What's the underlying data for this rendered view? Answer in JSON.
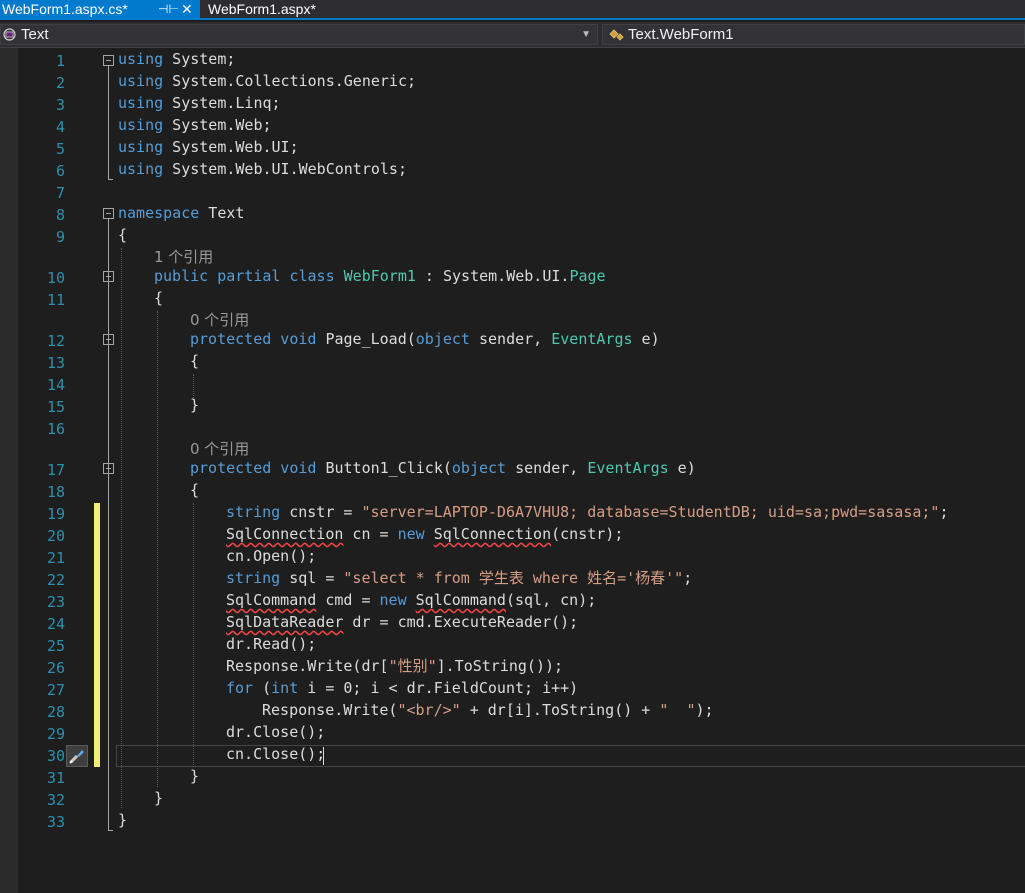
{
  "tabs": [
    {
      "label": "WebForm1.aspx.cs*",
      "active": true,
      "pinned_icon": "pin-icon",
      "close_icon": "close-icon"
    },
    {
      "label": "WebForm1.aspx*",
      "active": false
    }
  ],
  "navbar": {
    "project_dropdown": {
      "value": "Text",
      "icon": "csharp-project-icon"
    },
    "class_dropdown": {
      "value": "Text.WebForm1",
      "icon": "class-icon"
    }
  },
  "colors": {
    "keyword": "#569cd6",
    "type": "#4ec9b0",
    "string": "#d69d85",
    "text": "#dcdcdc",
    "line_number": "#2b91af",
    "hint": "#999999",
    "accent": "#007acc",
    "change_marker": "#efef7a",
    "error_squiggle": "#f44747"
  },
  "line_numbers": [
    "1",
    "2",
    "3",
    "4",
    "5",
    "6",
    "7",
    "8",
    "9",
    "10",
    "11",
    "12",
    "13",
    "14",
    "15",
    "16",
    "17",
    "18",
    "19",
    "20",
    "21",
    "22",
    "23",
    "24",
    "25",
    "26",
    "27",
    "28",
    "29",
    "30",
    "31",
    "32",
    "33"
  ],
  "hints": {
    "class_refs": "1 个引用",
    "page_load_refs": "0 个引用",
    "button_click_refs": "0 个引用"
  },
  "code": {
    "l1": {
      "kw": "using",
      "rest": " System;"
    },
    "l2": {
      "kw": "using",
      "rest": " System.Collections.Generic;"
    },
    "l3": {
      "kw": "using",
      "rest": " System.Linq;"
    },
    "l4": {
      "kw": "using",
      "rest": " System.Web;"
    },
    "l5": {
      "kw": "using",
      "rest": " System.Web.UI;"
    },
    "l6": {
      "kw": "using",
      "rest": " System.Web.UI.WebControls;"
    },
    "l8": {
      "kw": "namespace",
      "rest": " Text"
    },
    "l9": {
      "text": "{"
    },
    "l10": {
      "kw1": "public",
      "kw2": " partial",
      "kw3": " class",
      "name": " WebForm1",
      "sep": " : System.Web.UI.",
      "base": "Page"
    },
    "l11": {
      "text": "{"
    },
    "l12": {
      "kw1": "protected",
      "kw2": " void",
      "name": " Page_Load(",
      "kw3": "object",
      "p1": " sender, ",
      "ty": "EventArgs",
      "p2": " e)"
    },
    "l13": {
      "text": "{"
    },
    "l15": {
      "text": "}"
    },
    "l17": {
      "kw1": "protected",
      "kw2": " void",
      "name": " Button1_Click(",
      "kw3": "object",
      "p1": " sender, ",
      "ty": "EventArgs",
      "p2": " e)"
    },
    "l18": {
      "text": "{"
    },
    "l19": {
      "kw": "string",
      "mid": " cnstr = ",
      "str": "\"server=LAPTOP-D6A7VHU8; database=StudentDB; uid=sa;pwd=sasasa;\"",
      "end": ";"
    },
    "l20": {
      "t1": "SqlConnection",
      "mid1": " cn = ",
      "kw": "new",
      "sp": " ",
      "t2": "SqlConnection",
      "end": "(cnstr);"
    },
    "l21": {
      "text": "cn.Open();"
    },
    "l22": {
      "kw": "string",
      "mid": " sql = ",
      "str": "\"select * from 学生表 where 姓名='杨春'\"",
      "end": ";"
    },
    "l23": {
      "t1": "SqlCommand",
      "mid1": " cmd = ",
      "kw": "new",
      "sp": " ",
      "t2": "SqlCommand",
      "end": "(sql, cn);"
    },
    "l24": {
      "t1": "SqlDataReader",
      "end": " dr = cmd.ExecuteReader();"
    },
    "l25": {
      "text": "dr.Read();"
    },
    "l26": {
      "pre": "Response.Write(dr[",
      "str": "\"性别\"",
      "end": "].ToString());"
    },
    "l27": {
      "kw1": "for",
      "mid1": " (",
      "kw2": "int",
      "end": " i = 0; i < dr.FieldCount; i++)"
    },
    "l28": {
      "pre": "Response.Write(",
      "str1": "\"<br/>\"",
      "mid": " + dr[i].ToString() + ",
      "str2": "\"  \"",
      "end": ");"
    },
    "l29": {
      "text": "dr.Close();"
    },
    "l30": {
      "text": "cn.Close();"
    },
    "l31": {
      "text": "}"
    },
    "l32": {
      "text": "}"
    },
    "l33": {
      "text": "}"
    }
  }
}
